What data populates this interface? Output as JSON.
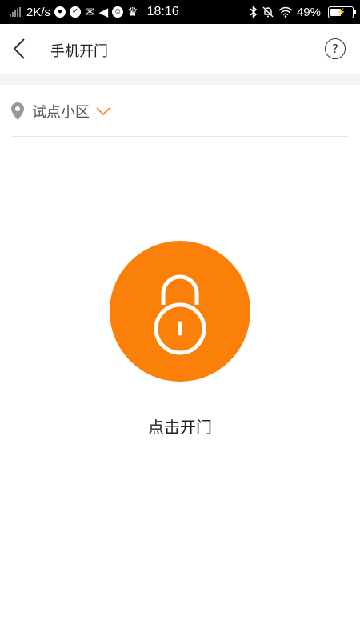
{
  "status_bar": {
    "speed": "2K/s",
    "time": "18:16",
    "battery_percent": "49%",
    "battery_level": 0.49
  },
  "header": {
    "title": "手机开门",
    "help_label": "?"
  },
  "community": {
    "name": "试点小区"
  },
  "unlock": {
    "label": "点击开门"
  },
  "colors": {
    "accent": "#fb8009",
    "status_bar_bg": "#000000"
  },
  "icons": [
    "signal-icon",
    "bluetooth-icon",
    "bell-mute-icon",
    "wifi-icon",
    "battery-icon",
    "back-arrow-icon",
    "help-icon",
    "location-pin-icon",
    "chevron-down-icon",
    "lock-icon"
  ]
}
